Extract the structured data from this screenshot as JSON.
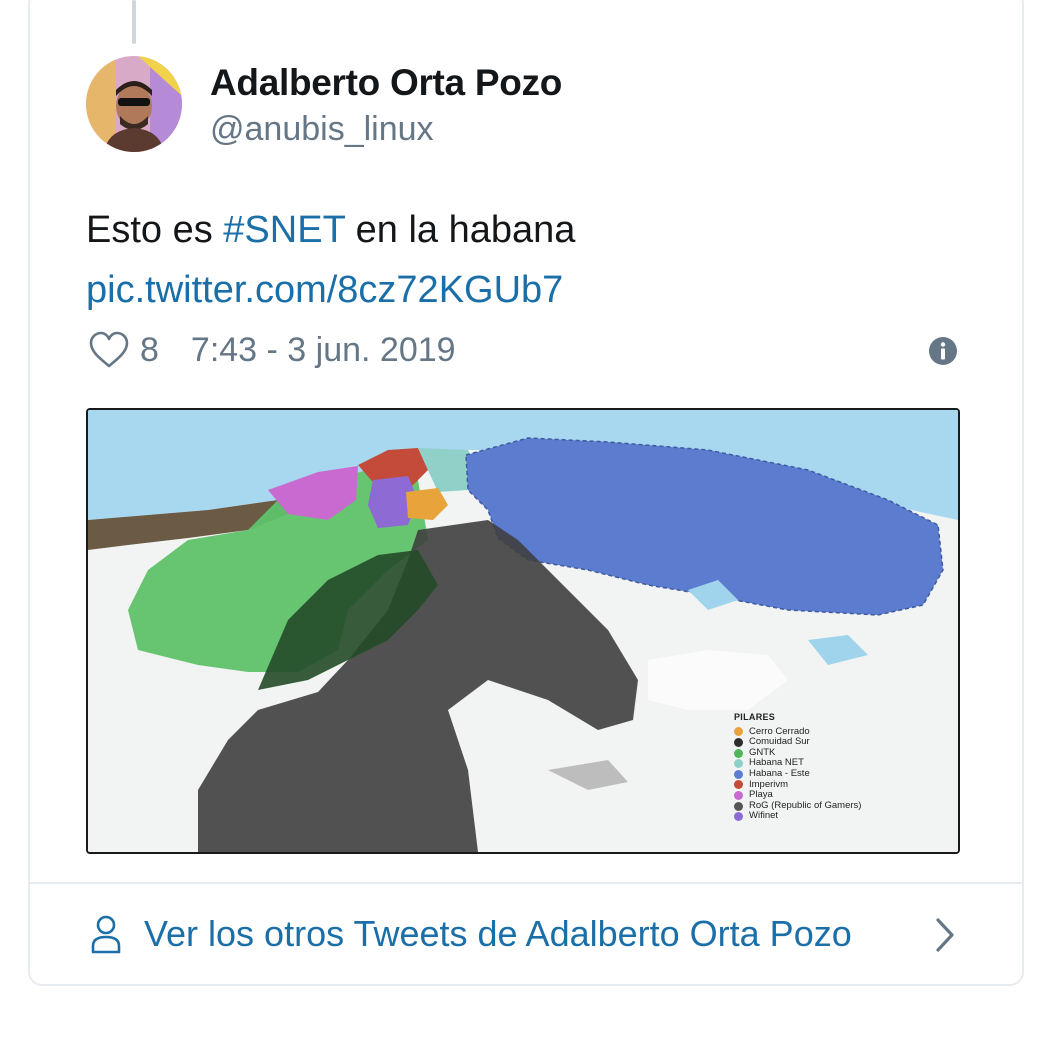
{
  "tweet": {
    "author_name": "Adalberto Orta Pozo",
    "author_handle": "@anubis_linux",
    "text_prefix": "Esto es ",
    "hashtag": "#SNET",
    "text_suffix": " en la habana",
    "pic_link": "pic.twitter.com/8cz72KGUb7",
    "likes": "8",
    "timestamp": "7:43 - 3 jun. 2019"
  },
  "map_legend": {
    "title": "PILARES",
    "items": [
      {
        "label": "Cerro Cerrado",
        "color": "#e8a33a"
      },
      {
        "label": "Comuidad Sur",
        "color": "#2e2e2e"
      },
      {
        "label": "GNTK",
        "color": "#4fb45a"
      },
      {
        "label": "Habana NET",
        "color": "#8fd1c8"
      },
      {
        "label": "Habana - Este",
        "color": "#5b7ccf"
      },
      {
        "label": "Imperivm",
        "color": "#c44a3a"
      },
      {
        "label": "Playa",
        "color": "#c86ad0"
      },
      {
        "label": "RoG (Republic of Gamers)",
        "color": "#555555"
      },
      {
        "label": "Wifinet",
        "color": "#8e6ad4"
      }
    ]
  },
  "footer": {
    "more_tweets_label": "Ver los otros Tweets de Adalberto Orta Pozo"
  },
  "colors": {
    "link": "#1b6fa8",
    "secondary_text": "#657786",
    "border": "#e6ecf0"
  }
}
